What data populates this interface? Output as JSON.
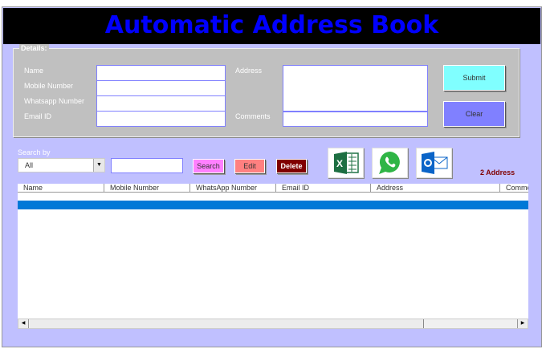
{
  "title": "Automatic Address Book",
  "details": {
    "legend": "Details:",
    "name_label": "Name",
    "mobile_label": "Mobile Number",
    "whatsapp_label": "Whatsapp Number",
    "email_label": "Email ID",
    "address_label": "Address",
    "comments_label": "Comments",
    "name": "",
    "mobile": "",
    "whatsapp": "",
    "email": "",
    "address": "",
    "comments": ""
  },
  "buttons": {
    "submit": "Submit",
    "clear": "Clear",
    "search": "Search",
    "edit": "Edit",
    "delete": "Delete"
  },
  "search": {
    "label": "Search by",
    "selected": "All",
    "query": ""
  },
  "count": "2 Address",
  "columns": [
    "Name",
    "Mobile Number",
    "WhatsApp Number",
    "Email ID",
    "Address",
    "Comme"
  ],
  "colors": {
    "form_bg": "#c0c0ff",
    "details_bg": "#c0c0c0",
    "submit": "#80ffff",
    "clear": "#8080ff",
    "search": "#ff80ff",
    "edit": "#ff8080",
    "delete": "#800000",
    "selection": "#0078d7"
  }
}
